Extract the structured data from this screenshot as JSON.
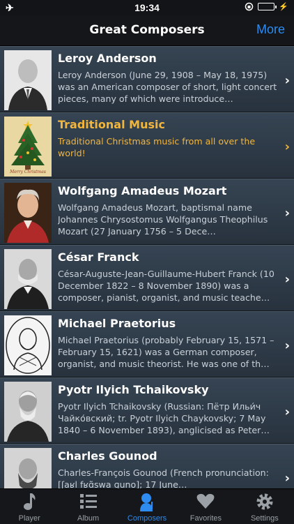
{
  "status_bar": {
    "time": "19:34"
  },
  "nav": {
    "title": "Great Composers",
    "more_label": "More"
  },
  "list": {
    "items": [
      {
        "name": "Leroy Anderson",
        "description": "Leroy Anderson (June 29, 1908 – May 18, 1975) was an American composer of short, light concert pieces, many of which were introduce…",
        "highlight": false
      },
      {
        "name": "Traditional Music",
        "description": "Traditional Christmas music from all over the world!",
        "highlight": true,
        "thumb_caption": "Merry Christmas"
      },
      {
        "name": "Wolfgang Amadeus Mozart",
        "description": "Wolfgang Amadeus Mozart, baptismal name Johannes Chrysostomus Wolfgangus Theophilus Mozart (27 January 1756 – 5 Dece…",
        "highlight": false
      },
      {
        "name": "César Franck",
        "description": "César-Auguste-Jean-Guillaume-Hubert Franck (10 December 1822 – 8 November 1890) was a composer, pianist, organist, and music teache…",
        "highlight": false
      },
      {
        "name": "Michael Praetorius",
        "description": "Michael Praetorius (probably February 15, 1571 – February 15, 1621) was a German composer, organist, and music theorist. He was one of th…",
        "highlight": false
      },
      {
        "name": "Pyotr Ilyich Tchaikovsky",
        "description": "Pyotr Ilyich Tchaikovsky (Russian: Пётр Ильи́ч Чайко́вский; tr. Pyotr Ilyich Chaykovsky; 7 May 1840 – 6 November 1893), anglicised as Peter…",
        "highlight": false
      },
      {
        "name": "Charles Gounod",
        "description": "Charles-François Gounod (French pronunciation: [ʃaʁl fʁɑ̃swa ɡuno]; 17 June…",
        "highlight": false
      }
    ]
  },
  "tabbar": {
    "tabs": [
      {
        "label": "Player",
        "icon": "music-note-icon"
      },
      {
        "label": "Album",
        "icon": "list-icon"
      },
      {
        "label": "Composers",
        "icon": "composer-icon",
        "active": true
      },
      {
        "label": "Favorites",
        "icon": "heart-icon"
      },
      {
        "label": "Settings",
        "icon": "gear-icon"
      }
    ]
  },
  "colors": {
    "accent": "#2e8bf0",
    "highlight": "#f3b63d",
    "battery": "#4cd964"
  }
}
